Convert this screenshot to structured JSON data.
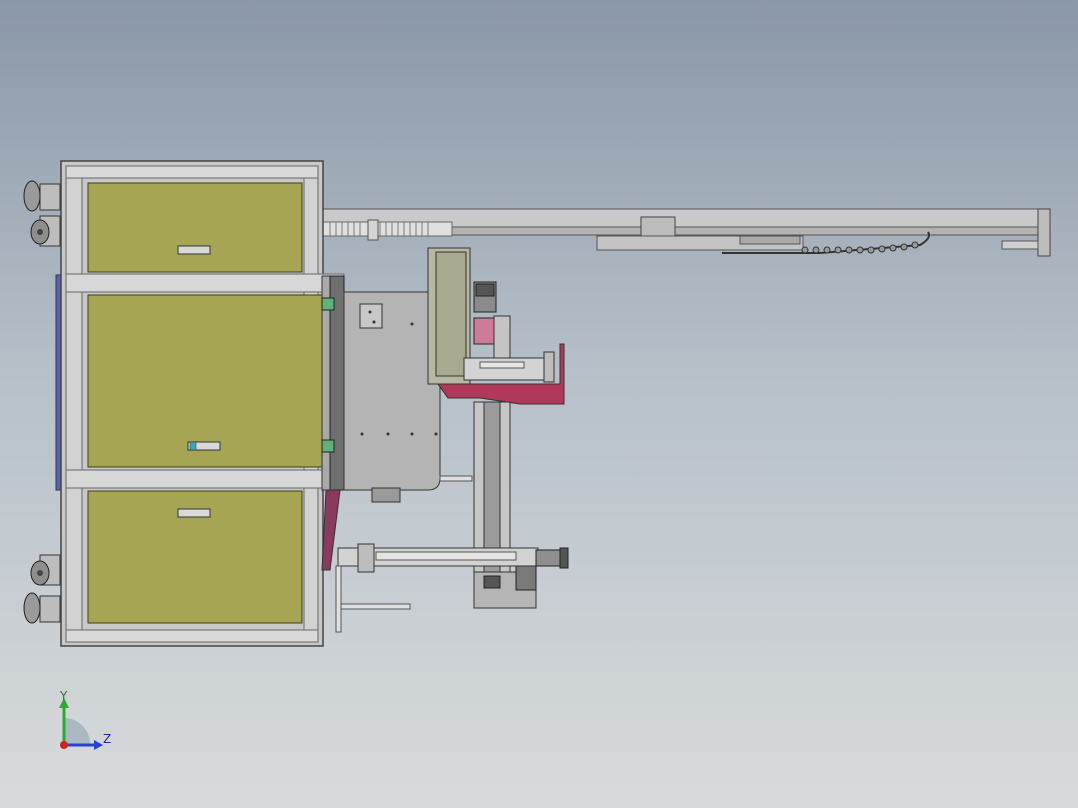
{
  "window": {
    "title": ""
  },
  "model_view": {
    "background_top": "#8a97a8",
    "background_bottom": "#d8dbdc",
    "cabinet_panel_color": "#a6a553",
    "frame_color": "#c4c4c4",
    "magenta_part_color": "#b0385a",
    "gray_part_color": "#b8b8b8"
  },
  "triad": {
    "y_label": "Y",
    "z_label": "Z",
    "y_color": "#2fa82f",
    "z_color": "#2a3fd6",
    "origin_color": "#d02020"
  }
}
